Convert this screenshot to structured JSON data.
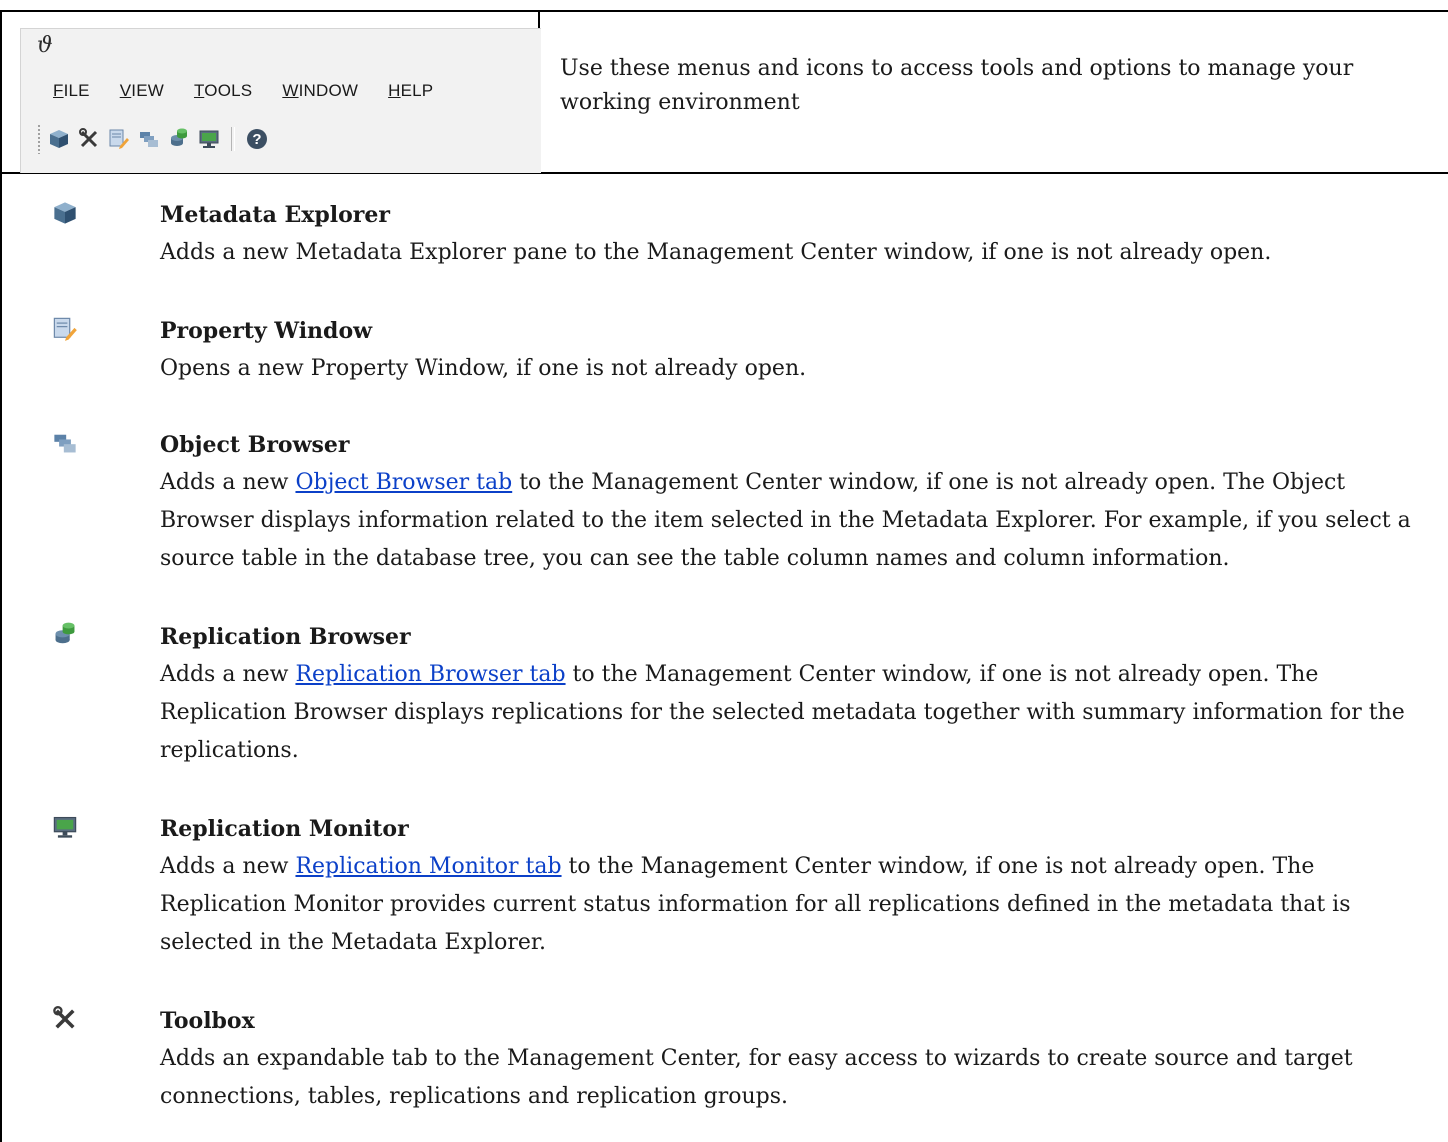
{
  "header": {
    "app_logo": "ϑ",
    "menus": [
      {
        "mnemonic": "F",
        "rest": "ILE"
      },
      {
        "mnemonic": "V",
        "rest": "IEW"
      },
      {
        "mnemonic": "T",
        "rest": "OOLS"
      },
      {
        "mnemonic": "W",
        "rest": "INDOW"
      },
      {
        "mnemonic": "H",
        "rest": "ELP"
      }
    ],
    "description": "Use these menus and icons to access tools and options to manage your working environment"
  },
  "items": [
    {
      "icon": "metadata-explorer-cube-icon",
      "title": "Metadata Explorer",
      "pre": "Adds a new Metadata Explorer pane to the Management Center window, if one is not already open.",
      "link": "",
      "post": ""
    },
    {
      "icon": "property-window-icon",
      "title": "Property Window",
      "pre": "Opens a new Property Window, if one is not already open.",
      "link": "",
      "post": ""
    },
    {
      "icon": "object-browser-icon",
      "title": "Object Browser",
      "pre": "Adds a new ",
      "link": "Object Browser tab",
      "post": " to the Management Center window, if one is not already open. The Object Browser displays information related to the item selected in the Metadata Explorer. For example, if you select a source table in the database tree, you can see the table column names and column information."
    },
    {
      "icon": "replication-browser-icon",
      "title": "Replication Browser",
      "pre": "Adds a new ",
      "link": "Replication Browser tab",
      "post": " to the Management Center window, if one is not already open.  The Replication Browser displays replications for the selected metadata together with summary information for the replications."
    },
    {
      "icon": "replication-monitor-icon",
      "title": "Replication Monitor",
      "pre": "Adds a new ",
      "link": "Replication Monitor tab",
      "post": " to the Management Center window, if one is not already open. The Replication Monitor provides current status information for all replications defined in the metadata that is selected in the Metadata Explorer."
    },
    {
      "icon": "toolbox-icon",
      "title": "Toolbox",
      "pre": "Adds an expandable tab to the Management Center, for easy access to wizards to create source and target connections, tables, replications and replication groups.",
      "link": "",
      "post": ""
    }
  ],
  "colors": {
    "link": "#0b40c8",
    "border": "#000000",
    "toolbar_bg": "#f2f2f2"
  }
}
